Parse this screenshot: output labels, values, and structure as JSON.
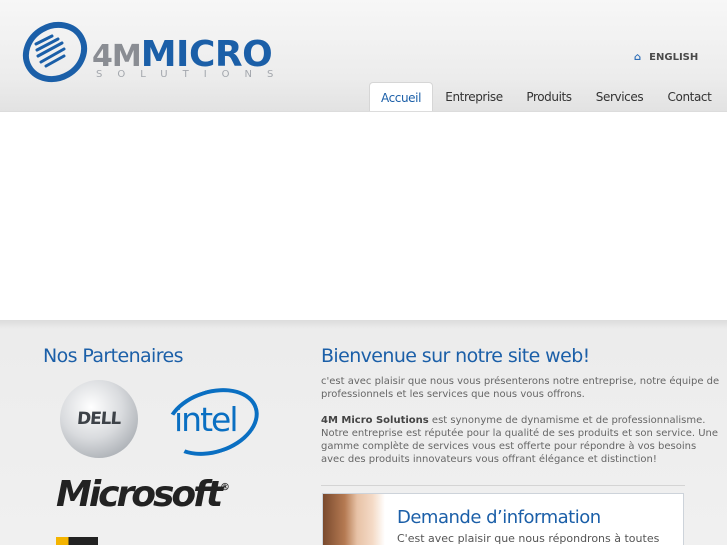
{
  "header": {
    "logo": {
      "main": "4M",
      "accent": "MICRO",
      "subtitle": "SOLUTIONS"
    },
    "language_label": "ENGLISH",
    "nav": [
      {
        "label": "Accueil",
        "active": true
      },
      {
        "label": "Entreprise",
        "active": false
      },
      {
        "label": "Produits",
        "active": false
      },
      {
        "label": "Services",
        "active": false
      },
      {
        "label": "Contact",
        "active": false
      }
    ]
  },
  "partners": {
    "title": "Nos Partenaires",
    "logos": [
      "DELL",
      "intel",
      "Microsoft"
    ]
  },
  "welcome": {
    "title": "Bienvenue sur notre site web!",
    "p1": "c'est avec plaisir que nous vous présenterons notre entreprise, notre équipe de professionnels et les services que nous vous offrons.",
    "p2_brand": "4M Micro Solutions",
    "p2_rest": " est synonyme de dynamisme et de professionnalisme. Notre entreprise est réputée pour la qualité de ses produits et son service. Une gamme complète de services vous est offerte pour répondre à vos besoins avec des produits innovateurs vous offrant élégance et distinction!"
  },
  "info_request": {
    "title": "Demande d’information",
    "text": "C'est avec plaisir que nous répondrons à toutes"
  },
  "colors": {
    "brand_blue": "#1b5fa8",
    "logo_gray": "#8a8d93"
  }
}
